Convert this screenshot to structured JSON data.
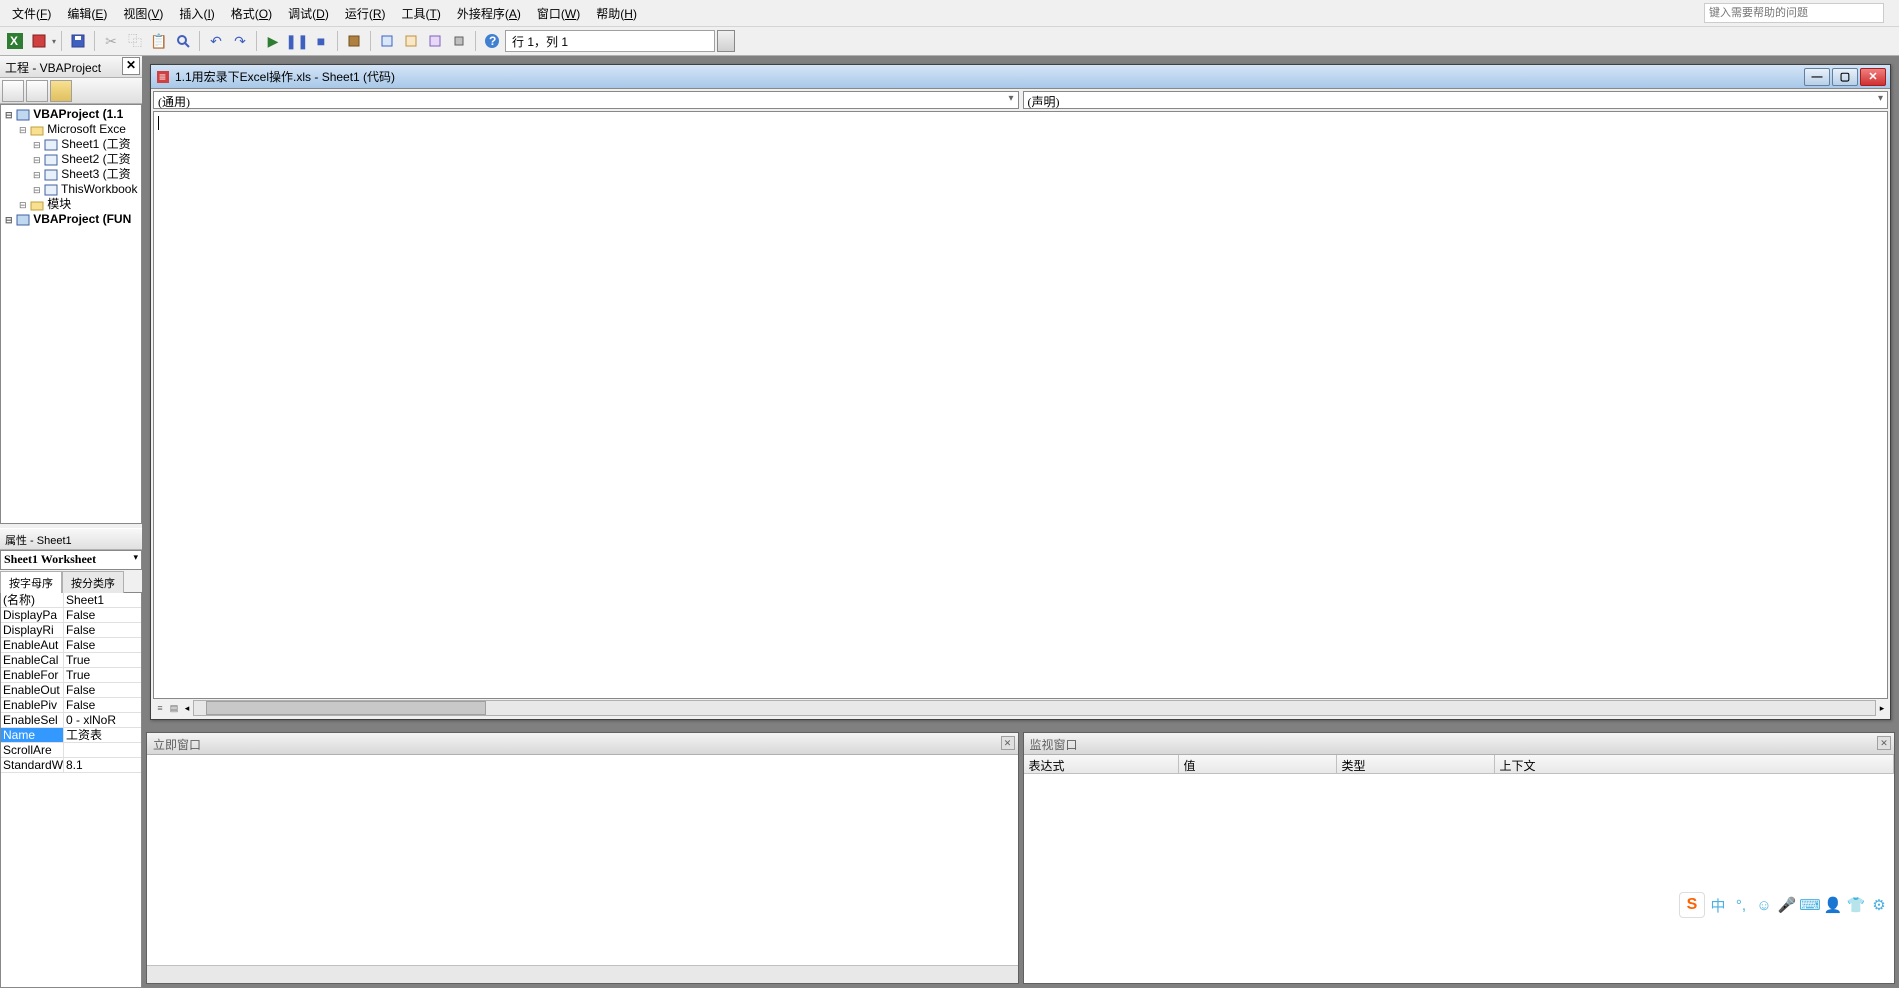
{
  "menubar": [
    {
      "label": "文件",
      "key": "F"
    },
    {
      "label": "编辑",
      "key": "E"
    },
    {
      "label": "视图",
      "key": "V"
    },
    {
      "label": "插入",
      "key": "I"
    },
    {
      "label": "格式",
      "key": "O"
    },
    {
      "label": "调试",
      "key": "D"
    },
    {
      "label": "运行",
      "key": "R"
    },
    {
      "label": "工具",
      "key": "T"
    },
    {
      "label": "外接程序",
      "key": "A"
    },
    {
      "label": "窗口",
      "key": "W"
    },
    {
      "label": "帮助",
      "key": "H"
    }
  ],
  "help_placeholder": "键入需要帮助的问题",
  "position_text": "行 1，列 1",
  "project_panel": {
    "title": "工程 - VBAProject",
    "tree": [
      {
        "indent": 0,
        "bold": true,
        "icon": "▸",
        "text": "VBAProject (1.1"
      },
      {
        "indent": 1,
        "bold": false,
        "icon": "▸",
        "text": "Microsoft Exce"
      },
      {
        "indent": 2,
        "bold": false,
        "icon": "",
        "text": "Sheet1 (工资"
      },
      {
        "indent": 2,
        "bold": false,
        "icon": "",
        "text": "Sheet2 (工资"
      },
      {
        "indent": 2,
        "bold": false,
        "icon": "",
        "text": "Sheet3 (工资"
      },
      {
        "indent": 2,
        "bold": false,
        "icon": "",
        "text": "ThisWorkbook"
      },
      {
        "indent": 1,
        "bold": false,
        "icon": "▸",
        "text": "模块"
      },
      {
        "indent": 0,
        "bold": true,
        "icon": "▸",
        "text": "VBAProject (FUN"
      }
    ]
  },
  "props_panel": {
    "title": "属性 - Sheet1",
    "object": "Sheet1 Worksheet",
    "tabs": [
      "按字母序",
      "按分类序"
    ],
    "rows": [
      {
        "k": "(名称)",
        "v": "Sheet1",
        "sel": false
      },
      {
        "k": "DisplayPa",
        "v": "False",
        "sel": false
      },
      {
        "k": "DisplayRi",
        "v": "False",
        "sel": false
      },
      {
        "k": "EnableAut",
        "v": "False",
        "sel": false
      },
      {
        "k": "EnableCal",
        "v": "True",
        "sel": false
      },
      {
        "k": "EnableFor",
        "v": "True",
        "sel": false
      },
      {
        "k": "EnableOut",
        "v": "False",
        "sel": false
      },
      {
        "k": "EnablePiv",
        "v": "False",
        "sel": false
      },
      {
        "k": "EnableSel",
        "v": "0 - xlNoR",
        "sel": false
      },
      {
        "k": "Name",
        "v": "工资表",
        "sel": true
      },
      {
        "k": "ScrollAre",
        "v": "",
        "sel": false
      },
      {
        "k": "StandardW",
        "v": "8.1",
        "sel": false
      }
    ]
  },
  "code_window": {
    "title": "1.1用宏录下Excel操作.xls - Sheet1 (代码)",
    "left_combo": "(通用)",
    "right_combo": "(声明)"
  },
  "immediate_panel": {
    "title": "立即窗口"
  },
  "watch_panel": {
    "title": "监视窗口",
    "cols": [
      "表达式",
      "值",
      "类型",
      "上下文"
    ]
  },
  "ime": {
    "logo": "S",
    "lang": "中"
  }
}
